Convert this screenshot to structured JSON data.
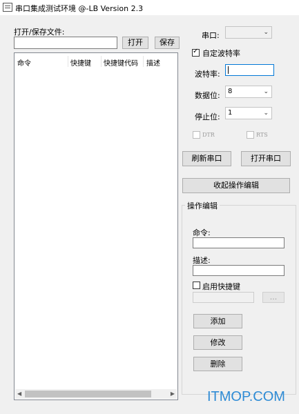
{
  "window": {
    "title": "串口集成测试环境 @-LB Version 2.3"
  },
  "file": {
    "label": "打开/保存文件:",
    "path_value": "",
    "open_label": "打开",
    "save_label": "保存"
  },
  "table": {
    "columns": [
      "命令",
      "快捷键",
      "快捷键代码",
      "描述"
    ],
    "rows": []
  },
  "serial": {
    "port_label": "串口:",
    "port_value": "",
    "custom_baud_label": "自定波特率",
    "custom_baud_checked": true,
    "baud_label": "波特率:",
    "baud_value": "",
    "databits_label": "数据位:",
    "databits_value": "8",
    "stopbits_label": "停止位:",
    "stopbits_value": "1",
    "dtr_label": "DTR",
    "rts_label": "RTS",
    "refresh_label": "刷新串口",
    "open_port_label": "打开串口",
    "collapse_label": "收起操作编辑"
  },
  "editor": {
    "group_title": "操作编辑",
    "command_label": "命令:",
    "command_value": "",
    "desc_label": "描述:",
    "desc_value": "",
    "hotkey_label": "启用快捷键",
    "hotkey_value": "",
    "browse_label": "...",
    "add_label": "添加",
    "modify_label": "修改",
    "delete_label": "删除"
  },
  "watermark": "ITMOP.COM",
  "colors": {
    "watermark": "#2e8bd5",
    "focus_border": "#0078d7"
  }
}
